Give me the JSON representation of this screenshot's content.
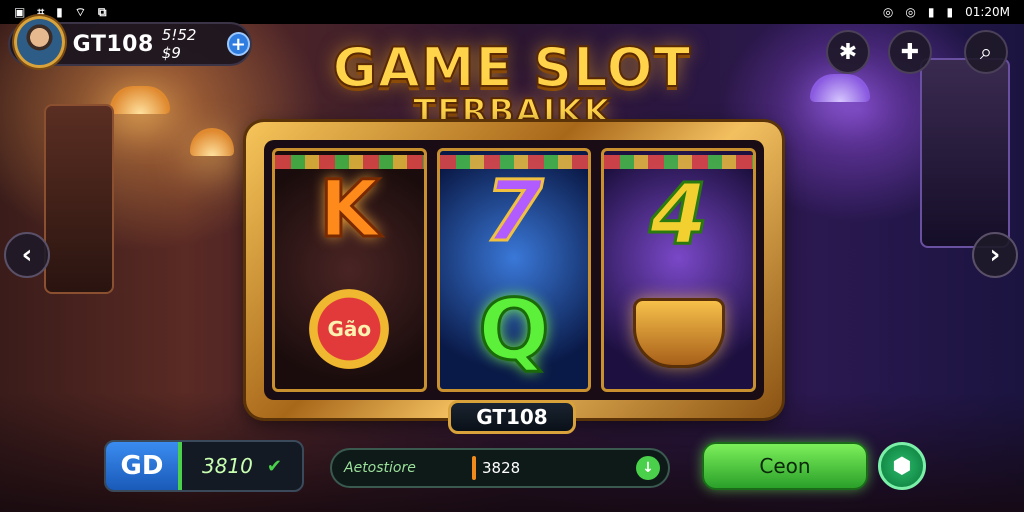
{
  "status_bar": {
    "left_glyphs": [
      "▣",
      "⌗",
      "▮",
      "⌔",
      "⧉"
    ],
    "right_glyphs": [
      "◎",
      "◎",
      "▮",
      "▮"
    ],
    "time": "01:20M"
  },
  "player": {
    "name": "GT108",
    "coins": "5!52 $9",
    "plus_label": "+"
  },
  "top_icons": {
    "star": "✱",
    "puzzle": "✚",
    "search": "⌕"
  },
  "title": {
    "line1": "GAME SLOT",
    "line2": "TERBAIKK"
  },
  "reels": {
    "reel1": {
      "top": "K",
      "bottom_coin": "Gão"
    },
    "reel2": {
      "top": "7",
      "bottom": "Q"
    },
    "reel3": {
      "top": "4"
    }
  },
  "brand_badge": "GT108",
  "nav": {
    "prev": "‹",
    "next": "›"
  },
  "bet": {
    "button_label": "GD",
    "value": "3810",
    "check": "✔"
  },
  "win": {
    "label": "Aetostiore",
    "value": "3828",
    "down": "↓"
  },
  "spin_label": "Ceon",
  "auto_label": "⬢",
  "colors": {
    "accent_gold": "#ffd34a",
    "spin_green": "#4ad04a",
    "gd_blue": "#2f7de1"
  }
}
